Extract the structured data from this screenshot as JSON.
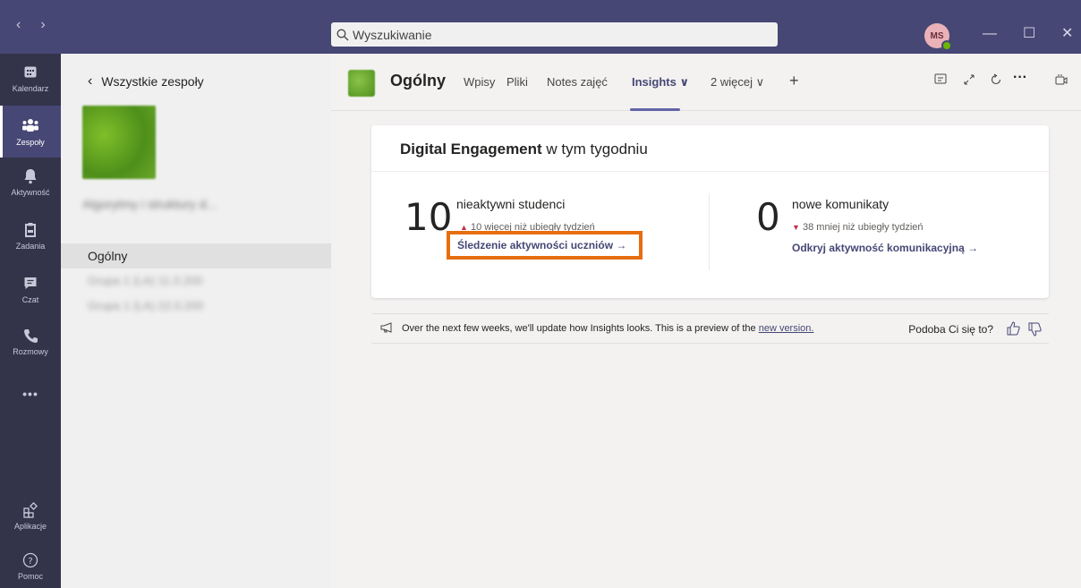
{
  "titlebar": {
    "back": "‹",
    "forward": "›",
    "search_placeholder": "Wyszukiwanie",
    "avatar_initials": "MS",
    "minimize": "—",
    "maximize": "☐",
    "close": "✕"
  },
  "rail": {
    "items": [
      {
        "label": "Kalendarz",
        "icon": "calendar-icon"
      },
      {
        "label": "Zespoły",
        "icon": "teams-icon",
        "active": true
      },
      {
        "label": "Aktywność",
        "icon": "bell-icon"
      },
      {
        "label": "Zadania",
        "icon": "assignments-icon"
      },
      {
        "label": "Czat",
        "icon": "chat-icon"
      },
      {
        "label": "Rozmowy",
        "icon": "phone-icon"
      },
      {
        "label": "Aplikacje",
        "icon": "apps-icon"
      },
      {
        "label": "Pomoc",
        "icon": "help-icon"
      }
    ],
    "more": "•••"
  },
  "sidebar": {
    "back_label": "Wszystkie zespoły",
    "team_name": "Algorytmy i struktury d...",
    "channels": [
      {
        "label": "Ogólny",
        "active": true
      },
      {
        "label": "Grupa 1 (LA) 11.0.200",
        "blurred": true
      },
      {
        "label": "Grupa 1 (LA) 22.0.200",
        "blurred": true
      }
    ]
  },
  "header": {
    "channel_title": "Ogólny",
    "tabs": [
      {
        "label": "Wpisy"
      },
      {
        "label": "Pliki"
      },
      {
        "label": "Notes zajęć"
      },
      {
        "label": "Insights ∨",
        "active": true
      },
      {
        "label": "2 więcej ∨"
      }
    ],
    "add_tab": "+",
    "more": "···"
  },
  "card": {
    "title_bold": "Digital Engagement",
    "title_rest": " w tym tygodniu",
    "stats": [
      {
        "value": "10",
        "label": "nieaktywni studenci",
        "change_arrow": "▲",
        "change_text": "10 więcej niż ubiegły tydzień",
        "link": "Śledzenie aktywności uczniów →"
      },
      {
        "value": "0",
        "label": "nowe komunikaty",
        "change_arrow": "▼",
        "change_text": "38 mniej niż ubiegły tydzień",
        "link": "Odkryj aktywność komunikacyjną →"
      }
    ]
  },
  "preview": {
    "text": "Over the next few weeks, we'll update how Insights looks. This is a preview of the ",
    "link": "new version.",
    "feedback_q": "Podoba Ci się to?"
  },
  "colors": {
    "titlebar": "#464775",
    "rail": "#33344a",
    "accent": "#6264a7",
    "highlight": "#e66e10",
    "up": "#c4314b",
    "down": "#c4314b"
  }
}
